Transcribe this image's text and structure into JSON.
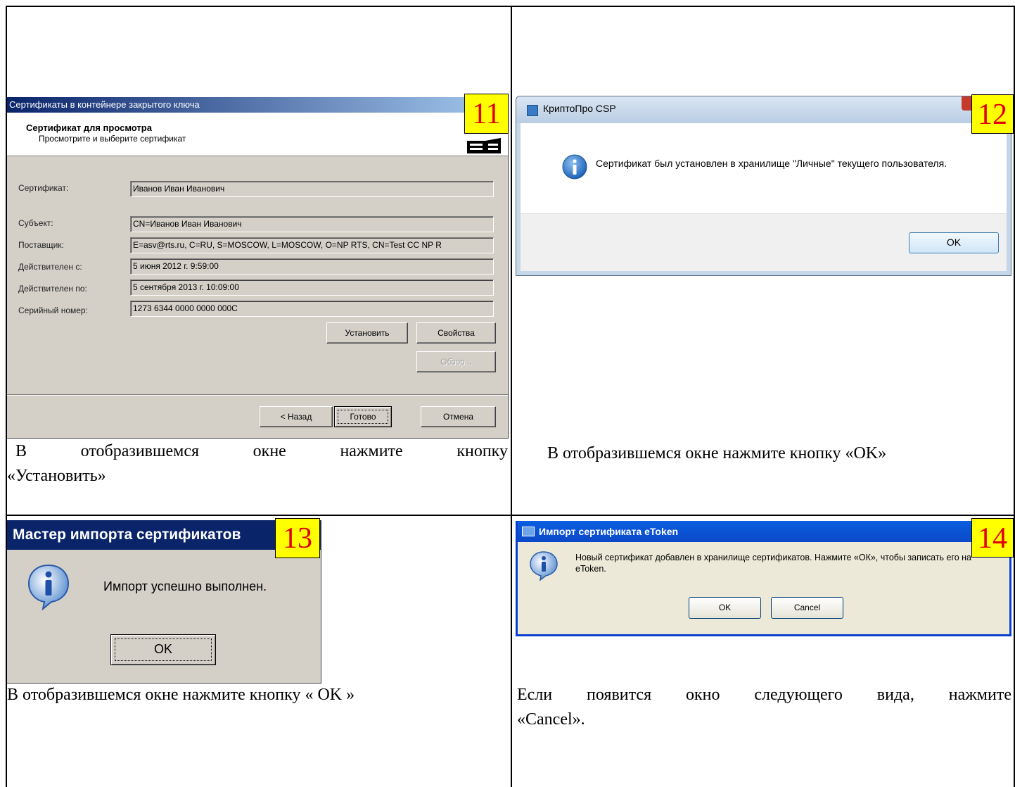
{
  "cells": {
    "c11": {
      "badge": "11",
      "caption_line1_words": [
        "В",
        "отобразившемся",
        "окне",
        "нажмите",
        "кнопку"
      ],
      "caption_line2": "«Установить»",
      "window": {
        "title": "Сертификаты в контейнере закрытого ключа",
        "header_title": "Сертификат для просмотра",
        "header_subtitle": "Просмотрите и выберите сертификат",
        "fields": [
          {
            "label": "Сертификат:",
            "value": "Иванов Иван Иванович"
          },
          {
            "label": "Субъект:",
            "value": "CN=Иванов Иван Иванович"
          },
          {
            "label": "Поставщик:",
            "value": "E=asv@rts.ru, C=RU, S=MOSCOW, L=MOSCOW, O=NP RTS, CN=Test CC NP R"
          },
          {
            "label": "Действителен с:",
            "value": "5 июня 2012 г. 9:59:00"
          },
          {
            "label": "Действителен по:",
            "value": "5 сентября 2013 г. 10:09:00"
          },
          {
            "label": "Серийный номер:",
            "value": "1273 6344 0000 0000 000C"
          }
        ],
        "buttons": {
          "install": "Установить",
          "properties": "Свойства",
          "browse": "Обзор...",
          "back": "< Назад",
          "finish": "Готово",
          "cancel": "Отмена"
        }
      }
    },
    "c12": {
      "badge": "12",
      "caption": "В отобразившемся окне нажмите кнопку «OK»",
      "window": {
        "title": "КриптоПро CSP",
        "message": "Сертификат был установлен в хранилище \"Личные\" текущего пользователя.",
        "ok": "OK"
      }
    },
    "c13": {
      "badge": "13",
      "caption": "В отобразившемся окне нажмите кнопку « OK »",
      "window": {
        "title": "Мастер импорта сертификатов",
        "message": "Импорт успешно выполнен.",
        "ok": "OK"
      }
    },
    "c14": {
      "badge": "14",
      "caption_line1_words": [
        "Если",
        "появится",
        "окно",
        "следующего",
        "вида,",
        "нажмите"
      ],
      "caption_line2": "«Cancel».",
      "window": {
        "title": "Импорт сертификата eToken",
        "message": "Новый сертификат добавлен в хранилище сертификатов. Нажмите «ОК», чтобы записать его на eToken.",
        "ok": "OK",
        "cancel": "Cancel"
      }
    }
  },
  "colors": {
    "badge_bg": "#ffff00",
    "badge_text": "#e00000",
    "classic_title": "#0a246a",
    "xp_title": "#0b48c8",
    "info_icon": "#1f63b8"
  },
  "icons": {
    "info": "info-icon",
    "wizard": "certificate-wizard-icon",
    "app": "cryptopro-icon"
  }
}
